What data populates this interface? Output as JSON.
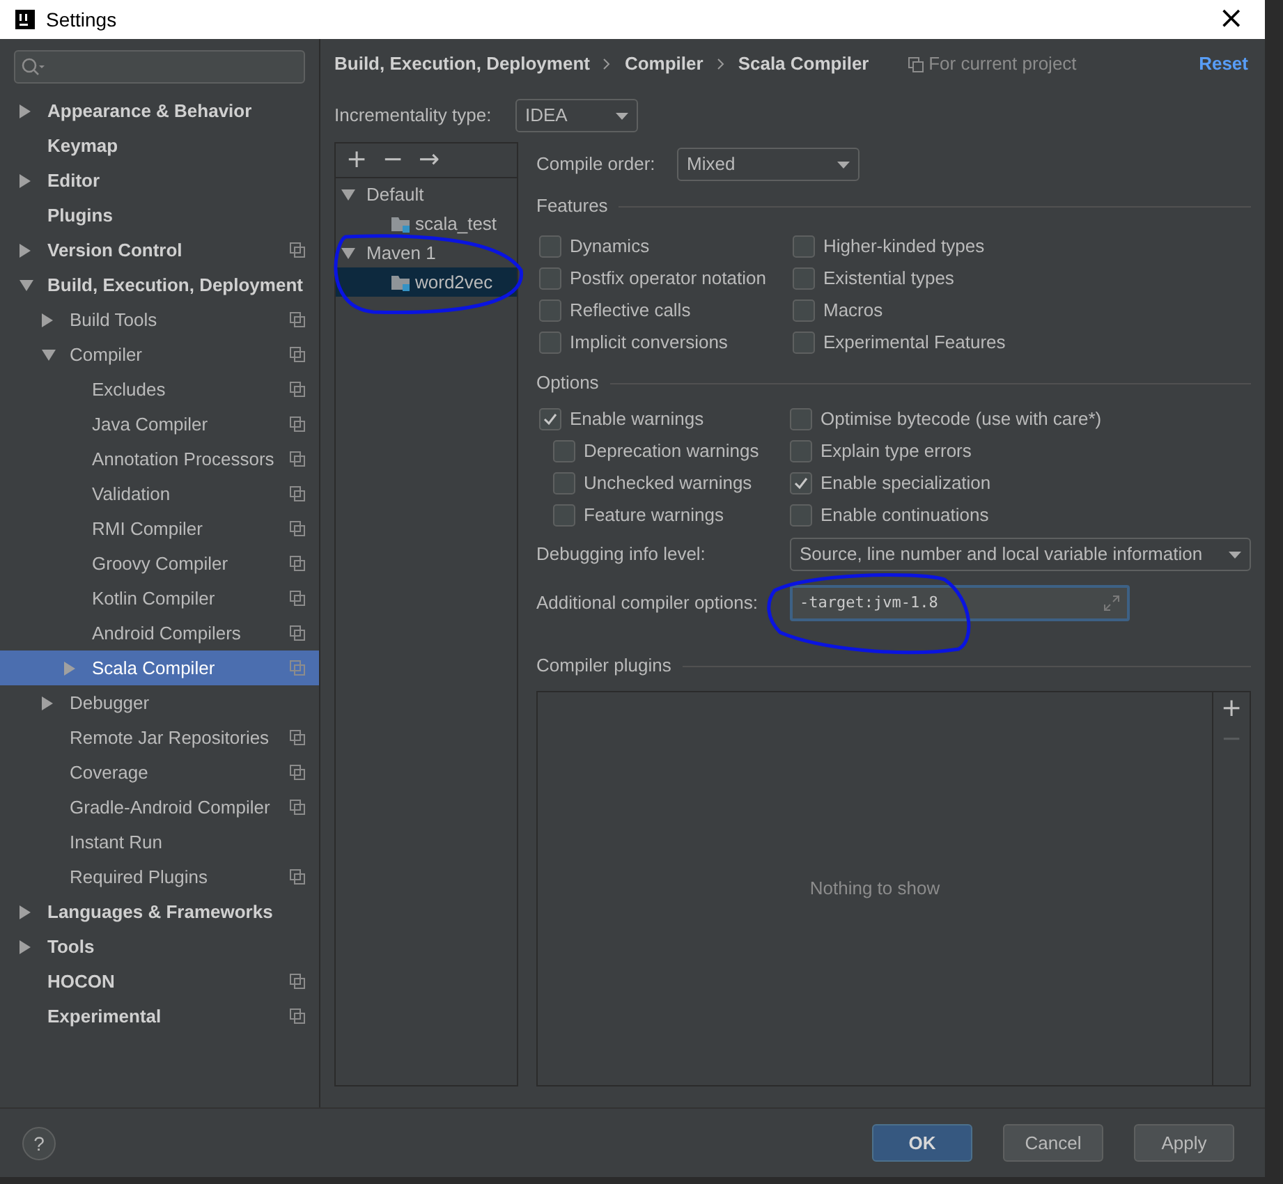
{
  "window": {
    "title": "Settings",
    "close": "×"
  },
  "sidebar": {
    "items": [
      {
        "label": "Appearance & Behavior",
        "kind": "group",
        "expanded": false,
        "project": false,
        "selected": false
      },
      {
        "label": "Keymap",
        "kind": "page",
        "project": false,
        "selected": false
      },
      {
        "label": "Editor",
        "kind": "group",
        "expanded": false,
        "project": false,
        "selected": false
      },
      {
        "label": "Plugins",
        "kind": "page",
        "project": false,
        "selected": false
      },
      {
        "label": "Version Control",
        "kind": "group",
        "expanded": false,
        "project": true,
        "selected": false
      },
      {
        "label": "Build, Execution, Deployment",
        "kind": "group",
        "expanded": true,
        "project": false,
        "selected": false,
        "children": [
          {
            "label": "Build Tools",
            "kind": "group",
            "expanded": false,
            "project": true,
            "selected": false
          },
          {
            "label": "Compiler",
            "kind": "group",
            "expanded": true,
            "project": true,
            "selected": false,
            "children": [
              {
                "label": "Excludes",
                "kind": "page",
                "project": true,
                "selected": false
              },
              {
                "label": "Java Compiler",
                "kind": "page",
                "project": true,
                "selected": false
              },
              {
                "label": "Annotation Processors",
                "kind": "page",
                "project": true,
                "selected": false
              },
              {
                "label": "Validation",
                "kind": "page",
                "project": true,
                "selected": false
              },
              {
                "label": "RMI Compiler",
                "kind": "page",
                "project": true,
                "selected": false
              },
              {
                "label": "Groovy Compiler",
                "kind": "page",
                "project": true,
                "selected": false
              },
              {
                "label": "Kotlin Compiler",
                "kind": "page",
                "project": true,
                "selected": false
              },
              {
                "label": "Android Compilers",
                "kind": "page",
                "project": true,
                "selected": false
              },
              {
                "label": "Scala Compiler",
                "kind": "group",
                "expanded": false,
                "project": true,
                "selected": true
              }
            ]
          },
          {
            "label": "Debugger",
            "kind": "group",
            "expanded": false,
            "project": false,
            "selected": false
          },
          {
            "label": "Remote Jar Repositories",
            "kind": "page",
            "project": true,
            "selected": false
          },
          {
            "label": "Coverage",
            "kind": "page",
            "project": true,
            "selected": false
          },
          {
            "label": "Gradle-Android Compiler",
            "kind": "page",
            "project": true,
            "selected": false
          },
          {
            "label": "Instant Run",
            "kind": "page",
            "project": false,
            "selected": false
          },
          {
            "label": "Required Plugins",
            "kind": "page",
            "project": true,
            "selected": false
          }
        ]
      },
      {
        "label": "Languages & Frameworks",
        "kind": "group",
        "expanded": false,
        "project": false,
        "selected": false
      },
      {
        "label": "Tools",
        "kind": "group",
        "expanded": false,
        "project": false,
        "selected": false
      },
      {
        "label": "HOCON",
        "kind": "page",
        "project": true,
        "selected": false
      },
      {
        "label": "Experimental",
        "kind": "page",
        "project": true,
        "selected": false
      }
    ]
  },
  "breadcrumb": [
    "Build, Execution, Deployment",
    "Compiler",
    "Scala Compiler"
  ],
  "scope_note": "For current project",
  "reset": "Reset",
  "incrementality": {
    "label": "Incrementality type:",
    "value": "IDEA"
  },
  "profiles": {
    "toolbar": [
      "+",
      "−",
      "→"
    ],
    "tree": [
      {
        "label": "Default",
        "expanded": true,
        "selected": false,
        "children": [
          {
            "label": "scala_test",
            "selected": false
          }
        ]
      },
      {
        "label": "Maven 1",
        "expanded": true,
        "selected": false,
        "children": [
          {
            "label": "word2vec",
            "selected": true
          }
        ]
      }
    ]
  },
  "compile_order": {
    "label": "Compile order:",
    "value": "Mixed"
  },
  "features": {
    "title": "Features",
    "checkboxes": [
      {
        "label": "Dynamics",
        "checked": false
      },
      {
        "label": "Higher-kinded types",
        "checked": false
      },
      {
        "label": "Postfix operator notation",
        "checked": false
      },
      {
        "label": "Existential types",
        "checked": false
      },
      {
        "label": "Reflective calls",
        "checked": false
      },
      {
        "label": "Macros",
        "checked": false
      },
      {
        "label": "Implicit conversions",
        "checked": false
      },
      {
        "label": "Experimental Features",
        "checked": false
      }
    ]
  },
  "options": {
    "title": "Options",
    "left": [
      {
        "label": "Enable warnings",
        "checked": true,
        "children": [
          {
            "label": "Deprecation warnings",
            "checked": false
          },
          {
            "label": "Unchecked warnings",
            "checked": false
          },
          {
            "label": "Feature warnings",
            "checked": false
          }
        ]
      }
    ],
    "right": [
      {
        "label": "Optimise bytecode (use with care*)",
        "checked": false
      },
      {
        "label": "Explain type errors",
        "checked": false
      },
      {
        "label": "Enable specialization",
        "checked": true
      },
      {
        "label": "Enable continuations",
        "checked": false
      }
    ]
  },
  "debugging": {
    "label": "Debugging info level:",
    "value": "Source, line number and local variable information"
  },
  "additional_options": {
    "label": "Additional compiler options:",
    "value": "-target:jvm-1.8",
    "focused": true
  },
  "plugins": {
    "title": "Compiler plugins",
    "empty_text": "Nothing to show",
    "toolbar": [
      {
        "label": "+",
        "disabled": false
      },
      {
        "label": "−",
        "disabled": true
      }
    ]
  },
  "help": "?",
  "buttons": [
    {
      "label": "OK",
      "kind": "primary"
    },
    {
      "label": "Cancel",
      "kind": "normal"
    },
    {
      "label": "Apply",
      "kind": "normal"
    }
  ],
  "annotations": [
    {
      "kind": "freehand-circle"
    },
    {
      "kind": "freehand-circle"
    }
  ]
}
